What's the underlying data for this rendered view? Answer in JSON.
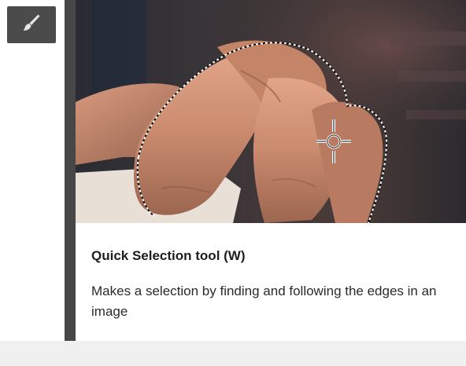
{
  "toolbar": {
    "active_tool_icon": "brush-icon"
  },
  "tooltip": {
    "title": "Quick Selection tool (W)",
    "description": "Makes a selection by finding and following the edges in an image",
    "preview_cursor_icon": "quick-selection-crosshair-icon"
  },
  "colors": {
    "tooltip_border": "#474747",
    "tool_button_bg": "#4b4b4b",
    "tooltip_bg": "#ffffff"
  }
}
